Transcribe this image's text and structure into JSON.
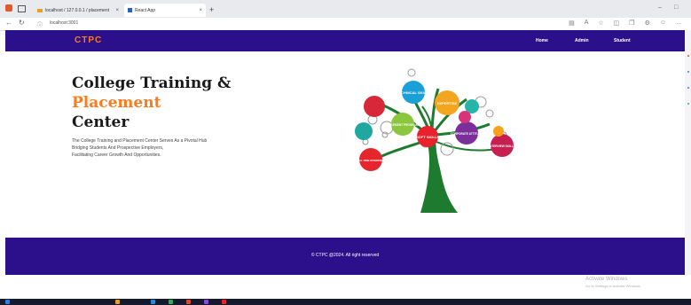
{
  "browser": {
    "tabs": [
      {
        "label": "localhost / 127.0.0.1 / placement"
      },
      {
        "label": "React App"
      }
    ],
    "new_tab": "+",
    "url": "localhost:3001"
  },
  "navbar": {
    "brand": "CTPC",
    "links": [
      "Home",
      "Admin",
      "Student"
    ]
  },
  "hero": {
    "title_line1": "College Training &",
    "title_line2": "Placement",
    "title_line3": "Center",
    "description": [
      "The College Training and Placement Center Serves As a Pivotal Hub",
      "Bridging Students And Prospective Employers,",
      "Facilitating Career Growth And Opportunities."
    ]
  },
  "tree_labels": {
    "technical": "TECHNICAL SKILLS",
    "expertise": "EXPERTISE",
    "placement": "PLACEMENT PROGRAMS",
    "corporate": "CORPORATE ATTITUDE",
    "soft": "SOFT SKILLS",
    "interview": "INTERVIEW SKILLS",
    "realtime": "REAL TIME INTERNSHIP"
  },
  "footer": {
    "text": "© CTPC @2024. All right reserved"
  },
  "os": {
    "activate_title": "Activate Windows",
    "activate_sub": "Go to Settings to activate Windows."
  },
  "colors": {
    "navbar": "#2c0f8a",
    "brand": "#ff7a1a",
    "accent": "#ff7a1a"
  }
}
